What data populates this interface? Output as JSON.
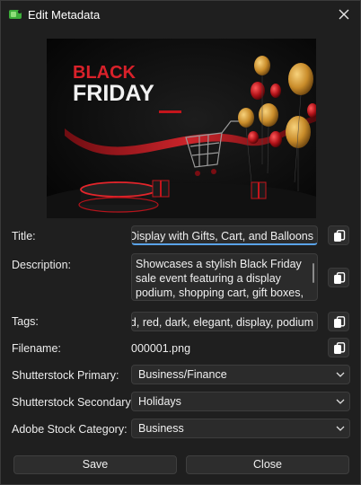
{
  "window": {
    "title": "Edit Metadata"
  },
  "preview": {
    "headline_line1": "BLACK",
    "headline_line2": "FRIDAY"
  },
  "form": {
    "title": {
      "label": "Title:",
      "value": "Black Friday Sale Podium Display with Gifts, Cart, and Balloons",
      "visible_text": "e Display with Gifts, Cart, and Balloons"
    },
    "description": {
      "label": "Description:",
      "lines": [
        "Showcases a stylish Black Friday",
        "sale event featuring a display",
        "podium, shopping cart, gift boxes,"
      ]
    },
    "tags": {
      "label": "Tags:",
      "visible_text": "old, red, dark, elegant, display, podium"
    },
    "filename": {
      "label": "Filename:",
      "value": "000001.png"
    },
    "shutterstock_primary": {
      "label": "Shutterstock Primary:",
      "value": "Business/Finance"
    },
    "shutterstock_secondary": {
      "label": "Shutterstock Secondary:",
      "value": "Holidays"
    },
    "adobe_stock_category": {
      "label": "Adobe Stock Category:",
      "value": "Business"
    }
  },
  "buttons": {
    "save": "Save",
    "close": "Close"
  },
  "colors": {
    "background": "#1f1f1f",
    "field": "#2b2b2b",
    "focus_accent": "#5aa3e8",
    "app_icon": "#3dae3a"
  },
  "icons": {
    "app": "app-icon",
    "close": "close-icon",
    "copy": "copy-icon",
    "dropdown": "chevron-down-icon"
  }
}
